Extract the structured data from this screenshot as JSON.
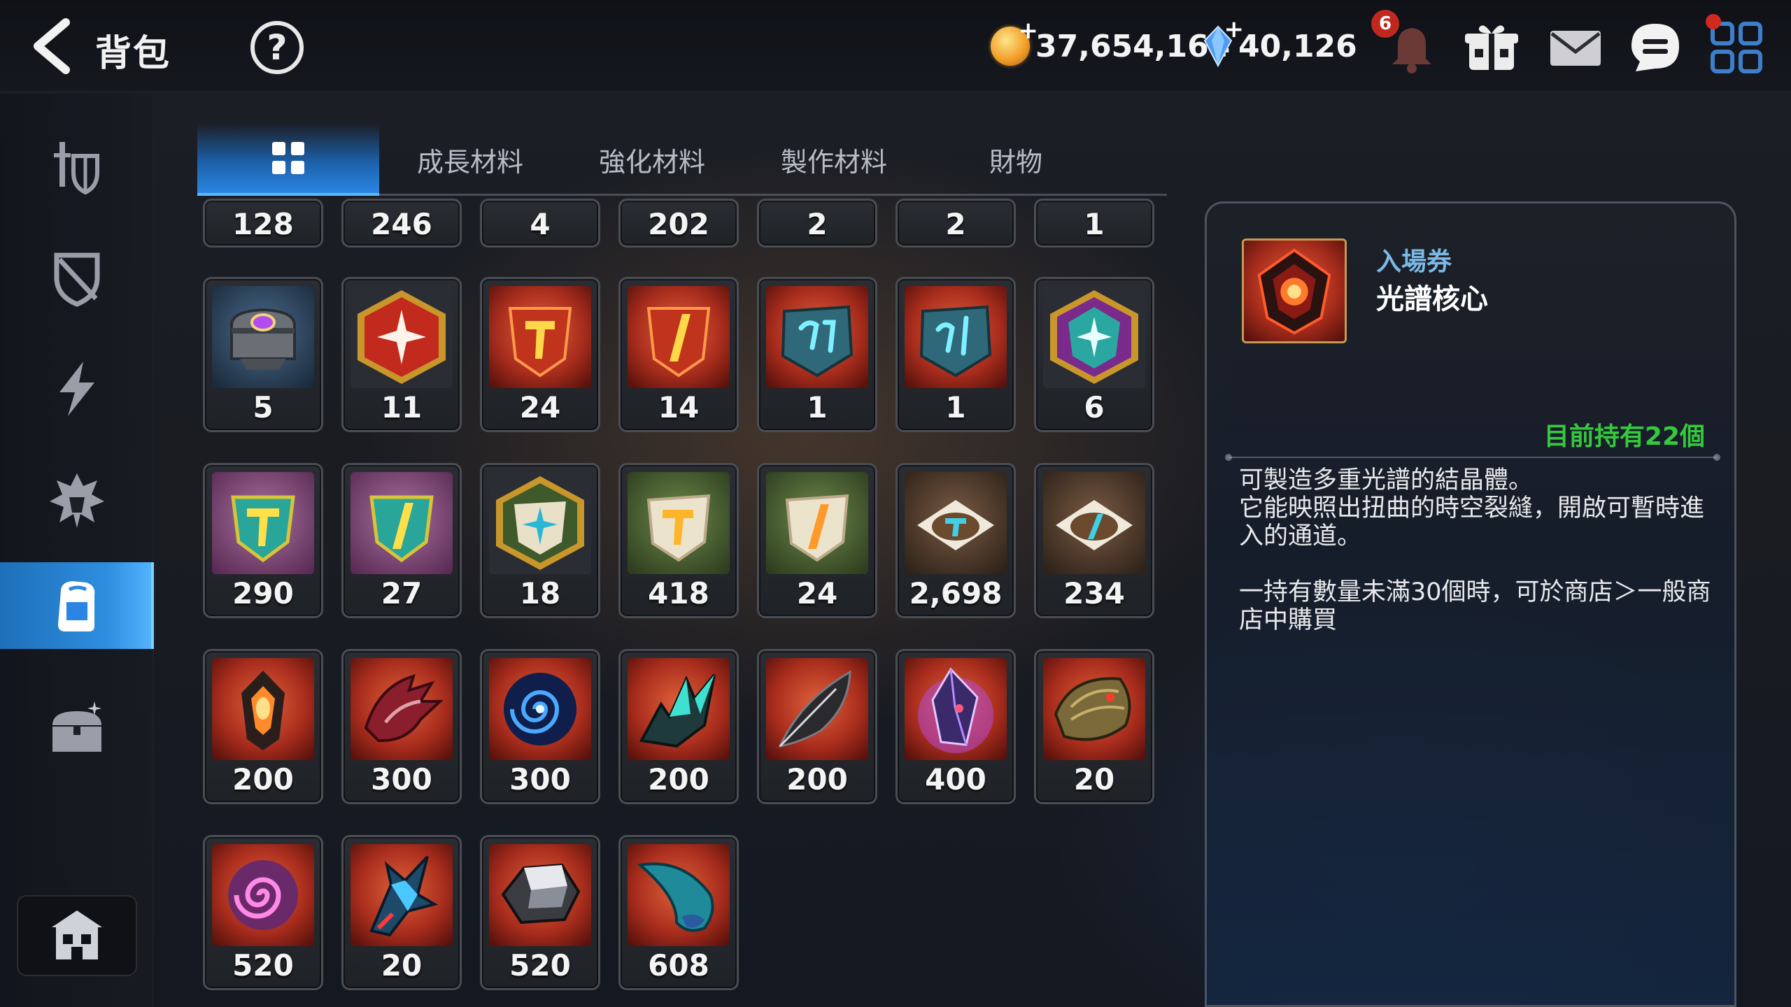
{
  "header": {
    "title": "背包",
    "help_label": "?",
    "gold": "37,654,164",
    "crystal": "40,126",
    "notification_count": "6"
  },
  "sidebar": {
    "items": [
      {
        "icon": "equipment-icon",
        "active": false
      },
      {
        "icon": "broken-shield-icon",
        "active": false
      },
      {
        "icon": "lightning-icon",
        "active": false
      },
      {
        "icon": "emblem-icon",
        "active": false
      },
      {
        "icon": "backpack-icon",
        "active": true
      },
      {
        "icon": "treasure-chest-icon",
        "active": false
      }
    ],
    "guild_icon": "guild-hall-icon"
  },
  "tabs": [
    {
      "label": "",
      "icon": "grid-icon",
      "active": true
    },
    {
      "label": "成長材料",
      "active": false
    },
    {
      "label": "強化材料",
      "active": false
    },
    {
      "label": "製作材料",
      "active": false
    },
    {
      "label": "財物",
      "active": false
    }
  ],
  "inventory": {
    "partial_row": [
      "128",
      "246",
      "4",
      "202",
      "2",
      "2",
      "1"
    ],
    "rows": [
      [
        {
          "qty": "5",
          "icon": "purple-gem-chest-icon"
        },
        {
          "qty": "11",
          "icon": "red-star-gem-icon"
        },
        {
          "qty": "24",
          "icon": "red-t-gem-icon"
        },
        {
          "qty": "14",
          "icon": "red-i-gem-icon"
        },
        {
          "qty": "1",
          "icon": "blue-hammer-rune-icon"
        },
        {
          "qty": "1",
          "icon": "blue-rune-icon"
        },
        {
          "qty": "6",
          "icon": "teal-star-gem-icon"
        }
      ],
      [
        {
          "qty": "290",
          "icon": "yellow-t-crystal-icon"
        },
        {
          "qty": "27",
          "icon": "yellow-i-crystal-icon"
        },
        {
          "qty": "18",
          "icon": "white-star-stone-icon"
        },
        {
          "qty": "418",
          "icon": "white-t-stone-icon"
        },
        {
          "qty": "24",
          "icon": "white-i-stone-icon"
        },
        {
          "qty": "2,698",
          "icon": "t-rune-powder-icon"
        },
        {
          "qty": "234",
          "icon": "i-rune-powder-icon"
        }
      ],
      [
        {
          "qty": "200",
          "icon": "fire-shard-icon"
        },
        {
          "qty": "300",
          "icon": "crimson-claw-icon"
        },
        {
          "qty": "300",
          "icon": "blue-vortex-icon"
        },
        {
          "qty": "200",
          "icon": "teal-crystal-cluster-icon"
        },
        {
          "qty": "200",
          "icon": "dark-feather-icon"
        },
        {
          "qty": "400",
          "icon": "violet-crystal-icon"
        },
        {
          "qty": "20",
          "icon": "bronze-scale-icon"
        }
      ],
      [
        {
          "qty": "520",
          "icon": "pink-spiral-icon"
        },
        {
          "qty": "20",
          "icon": "azure-spike-icon"
        },
        {
          "qty": "520",
          "icon": "silver-ore-icon"
        },
        {
          "qty": "608",
          "icon": "blue-fang-icon"
        }
      ]
    ]
  },
  "detail": {
    "category": "入場券",
    "name": "光譜核心",
    "owned": "目前持有22個",
    "desc1": "可製造多重光譜的結晶體。",
    "desc2": "它能映照出扭曲的時空裂縫，開啟可暫時進入的通道。",
    "desc3": "一持有數量未滿30個時，可於商店＞一般商店中購買",
    "icon": "spectrum-core-icon"
  },
  "colors": {
    "accent": "#2a86e2",
    "owned_green": "#35c93c",
    "category_blue": "#7db9e6",
    "slot_bg_red": "#9a2a1c"
  }
}
